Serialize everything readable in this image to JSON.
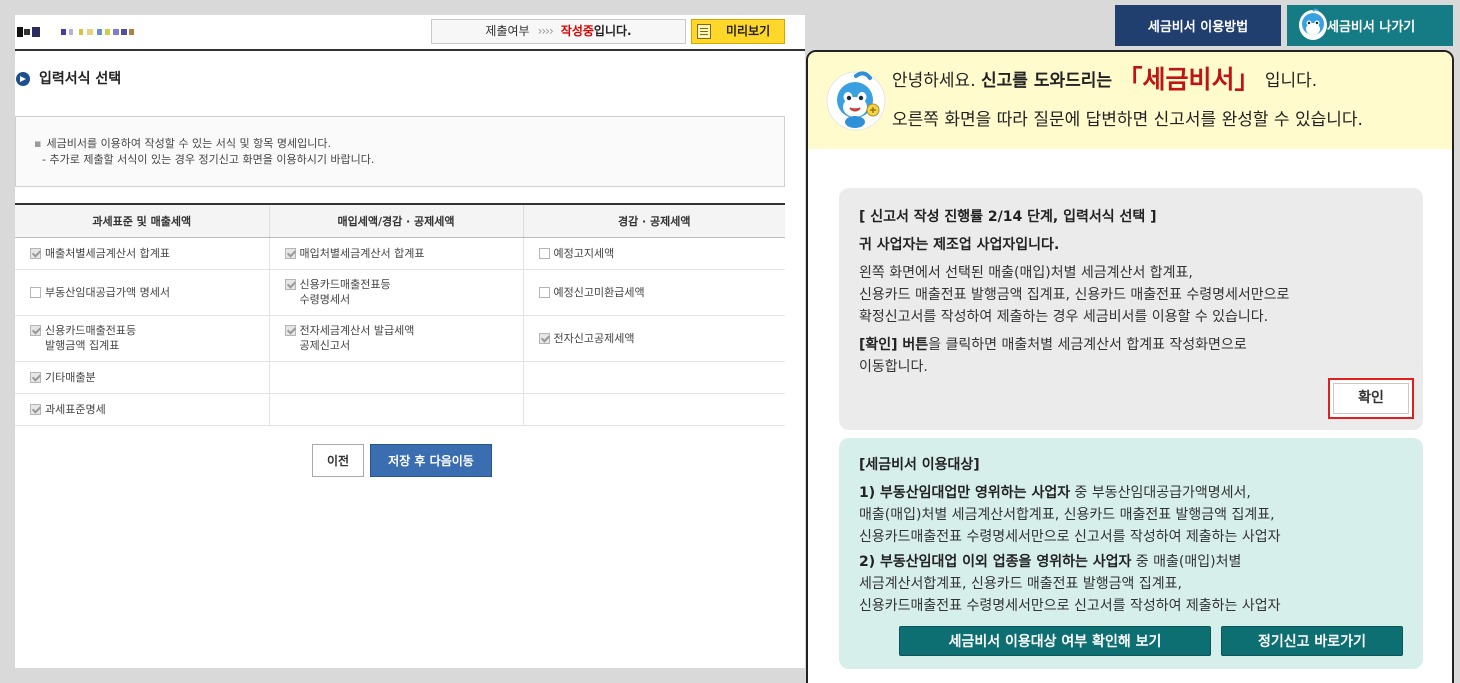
{
  "header": {
    "submission_label": "제출여부",
    "arrows": "››››",
    "status_current": "작성중",
    "status_suffix": "입니다.",
    "preview_label": "미리보기"
  },
  "section": {
    "title": "입력서식 선택"
  },
  "info": {
    "line1": "세금비서를 이용하여 작성할 수 있는 서식 및 항목 명세입니다.",
    "line2": "- 추가로 제출할 서식이 있는 경우 정기신고 화면을 이용하시기 바랍니다."
  },
  "table": {
    "headers": [
      "과세표준 및 매출세액",
      "매입세액/경감 · 공제세액",
      "경감 · 공제세액"
    ],
    "rows": [
      [
        {
          "label": "매출처별세금계산서 합계표",
          "checked": true
        },
        {
          "label": "매입처별세금계산서 합계표",
          "checked": true
        },
        {
          "label": "예정고지세액",
          "checked": false
        }
      ],
      [
        {
          "label": "부동산임대공급가액 명세서",
          "checked": false
        },
        {
          "label": "신용카드매출전표등\n수령명세서",
          "checked": true
        },
        {
          "label": "예정신고미환급세액",
          "checked": false
        }
      ],
      [
        {
          "label": "신용카드매출전표등\n발행금액 집계표",
          "checked": true
        },
        {
          "label": "전자세금계산서 발급세액\n공제신고서",
          "checked": true
        },
        {
          "label": "전자신고공제세액",
          "checked": true
        }
      ],
      [
        {
          "label": "기타매출분",
          "checked": true
        },
        null,
        null
      ],
      [
        {
          "label": "과세표준명세",
          "checked": true
        },
        null,
        null
      ]
    ]
  },
  "buttons": {
    "prev": "이전",
    "save_next": "저장 후 다음이동",
    "guide": "세금비서 이용방법",
    "exit": "세금비서 나가기"
  },
  "assistant": {
    "greet_hello": "안녕하세요.",
    "greet_help": "신고를 도와드리는",
    "greet_brand": "「세금비서」",
    "greet_tail": "입니다.",
    "greet_line2": "오른쪽 화면을 따라 질문에 답변하면 신고서를 완성할 수 있습니다.",
    "step": {
      "title": "[ 신고서 작성 진행률 2/14 단계, 입력서식 선택 ]",
      "business": "귀 사업자는 제조업 사업자입니다.",
      "p1": "왼쪽 화면에서 선택된 매출(매입)처별 세금계산서 합계표,",
      "p2": "신용카드 매출전표 발행금액 집계표, 신용카드 매출전표 수령명세서만으로",
      "p3": "확정신고서를 작성하여 제출하는 경우 세금비서를 이용할 수 있습니다.",
      "confirm_bold": "[확인] 버튼",
      "confirm_rest": "을 클릭하면 매출처별 세금계산서 합계표 작성화면으로",
      "confirm_rest2": "이동합니다.",
      "confirm_button": "확인"
    },
    "target": {
      "title": "[세금비서 이용대상]",
      "item1_bold": "1) 부동산임대업만 영위하는 사업자",
      "item1_rest": " 중 부동산임대공급가액명세서,",
      "item1_l2": "매출(매입)처별 세금계산서합계표, 신용카드 매출전표 발행금액 집계표,",
      "item1_l3": "신용카드매출전표 수령명세서만으로 신고서를 작성하여 제출하는 사업자",
      "item2_bold": "2) 부동산임대업 이외 업종을 영위하는 사업자",
      "item2_rest": " 중 매출(매입)처별",
      "item2_l2": "세금계산서합계표, 신용카드 매출전표 발행금액 집계표,",
      "item2_l3": "신용카드매출전표 수령명세서만으로 신고서를 작성하여 제출하는 사업자",
      "check_button": "세금비서 이용대상 여부 확인해 보기",
      "regular_button": "정기신고 바로가기"
    }
  },
  "colors": {
    "brand_red": "#c01414",
    "navy": "#213f6e",
    "teal": "#157c85",
    "dark_teal": "#0e6f73",
    "highlight_yellow": "#fffbcd",
    "mint": "#d6efeb"
  }
}
